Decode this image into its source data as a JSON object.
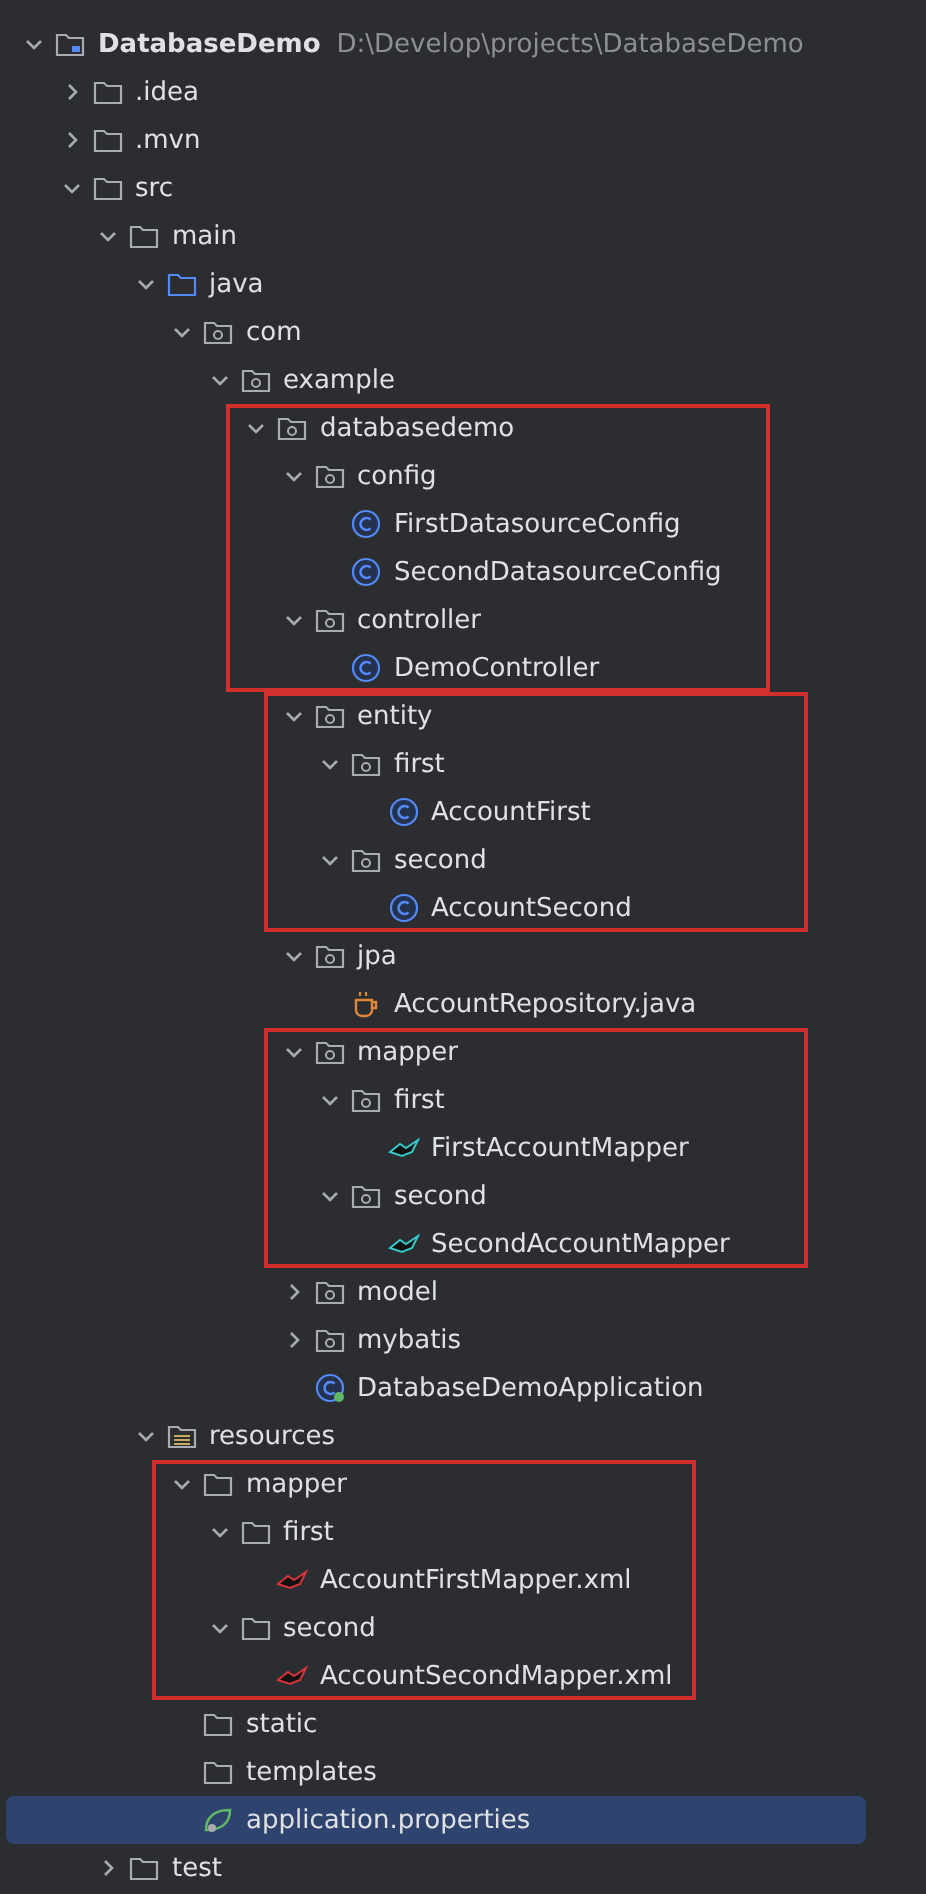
{
  "tree": [
    {
      "kind": "module",
      "label": "DatabaseDemo",
      "path": "D:\\Develop\\projects\\DatabaseDemo",
      "expanded": true,
      "selected": false,
      "children": [
        {
          "kind": "folder",
          "label": ".idea",
          "expanded": false,
          "selected": false
        },
        {
          "kind": "folder",
          "label": ".mvn",
          "expanded": false,
          "selected": false
        },
        {
          "kind": "folder",
          "label": "src",
          "expanded": true,
          "selected": false,
          "children": [
            {
              "kind": "folder",
              "label": "main",
              "expanded": true,
              "selected": false,
              "children": [
                {
                  "kind": "source-root",
                  "label": "java",
                  "expanded": true,
                  "selected": false,
                  "children": [
                    {
                      "kind": "package",
                      "label": "com",
                      "expanded": true,
                      "selected": false,
                      "children": [
                        {
                          "kind": "package",
                          "label": "example",
                          "expanded": true,
                          "selected": false,
                          "children": [
                            {
                              "kind": "package",
                              "label": "databasedemo",
                              "expanded": true,
                              "selected": false,
                              "frame_start": true,
                              "children": [
                                {
                                  "kind": "package",
                                  "label": "config",
                                  "expanded": true,
                                  "selected": false,
                                  "children": [
                                    {
                                      "kind": "class",
                                      "label": "FirstDatasourceConfig",
                                      "selected": false
                                    },
                                    {
                                      "kind": "class",
                                      "label": "SecondDatasourceConfig",
                                      "selected": false
                                    }
                                  ]
                                },
                                {
                                  "kind": "package",
                                  "label": "controller",
                                  "expanded": true,
                                  "selected": false,
                                  "children": [
                                    {
                                      "kind": "class",
                                      "label": "DemoController",
                                      "selected": false,
                                      "frame_end": true
                                    }
                                  ]
                                },
                                {
                                  "kind": "package",
                                  "label": "entity",
                                  "expanded": true,
                                  "selected": false,
                                  "frame_start": true,
                                  "children": [
                                    {
                                      "kind": "package",
                                      "label": "first",
                                      "expanded": true,
                                      "selected": false,
                                      "children": [
                                        {
                                          "kind": "class",
                                          "label": "AccountFirst",
                                          "selected": false
                                        }
                                      ]
                                    },
                                    {
                                      "kind": "package",
                                      "label": "second",
                                      "expanded": true,
                                      "selected": false,
                                      "children": [
                                        {
                                          "kind": "class",
                                          "label": "AccountSecond",
                                          "selected": false,
                                          "frame_end": true
                                        }
                                      ]
                                    }
                                  ]
                                },
                                {
                                  "kind": "package",
                                  "label": "jpa",
                                  "expanded": true,
                                  "selected": false,
                                  "children": [
                                    {
                                      "kind": "java-file",
                                      "label": "AccountRepository.java",
                                      "selected": false
                                    }
                                  ]
                                },
                                {
                                  "kind": "package",
                                  "label": "mapper",
                                  "expanded": true,
                                  "selected": false,
                                  "frame_start": true,
                                  "children": [
                                    {
                                      "kind": "package",
                                      "label": "first",
                                      "expanded": true,
                                      "selected": false,
                                      "children": [
                                        {
                                          "kind": "mapper",
                                          "label": "FirstAccountMapper",
                                          "selected": false
                                        }
                                      ]
                                    },
                                    {
                                      "kind": "package",
                                      "label": "second",
                                      "expanded": true,
                                      "selected": false,
                                      "children": [
                                        {
                                          "kind": "mapper",
                                          "label": "SecondAccountMapper",
                                          "selected": false,
                                          "frame_end": true
                                        }
                                      ]
                                    }
                                  ]
                                },
                                {
                                  "kind": "package",
                                  "label": "model",
                                  "expanded": false,
                                  "selected": false
                                },
                                {
                                  "kind": "package",
                                  "label": "mybatis",
                                  "expanded": false,
                                  "selected": false
                                },
                                {
                                  "kind": "spring-class",
                                  "label": "DatabaseDemoApplication",
                                  "selected": false
                                }
                              ]
                            }
                          ]
                        }
                      ]
                    }
                  ]
                },
                {
                  "kind": "resources-root",
                  "label": "resources",
                  "expanded": true,
                  "selected": false,
                  "children": [
                    {
                      "kind": "folder",
                      "label": "mapper",
                      "expanded": true,
                      "selected": false,
                      "frame_start": true,
                      "children": [
                        {
                          "kind": "folder",
                          "label": "first",
                          "expanded": true,
                          "selected": false,
                          "children": [
                            {
                              "kind": "xml",
                              "label": "AccountFirstMapper.xml",
                              "selected": false
                            }
                          ]
                        },
                        {
                          "kind": "folder",
                          "label": "second",
                          "expanded": true,
                          "selected": false,
                          "children": [
                            {
                              "kind": "xml",
                              "label": "AccountSecondMapper.xml",
                              "selected": false,
                              "frame_end": true
                            }
                          ]
                        }
                      ]
                    },
                    {
                      "kind": "folder",
                      "label": "static",
                      "selected": false
                    },
                    {
                      "kind": "folder",
                      "label": "templates",
                      "selected": false
                    },
                    {
                      "kind": "properties",
                      "label": "application.properties",
                      "selected": true
                    }
                  ]
                }
              ]
            },
            {
              "kind": "folder",
              "label": "test",
              "expanded": false,
              "selected": false
            }
          ]
        }
      ]
    }
  ]
}
